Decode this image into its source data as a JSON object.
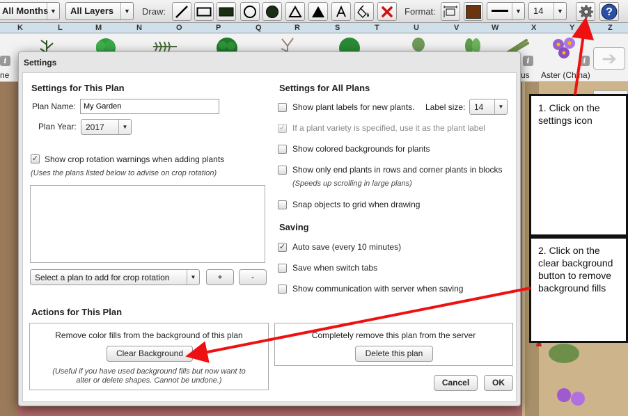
{
  "toolbar": {
    "months_label": "All Months",
    "layers_label": "All Layers",
    "draw_label": "Draw:",
    "format_label": "Format:",
    "label_size": "14",
    "colors": {
      "fill_swatch": "#6b3510",
      "delete_red": "#d01010",
      "help_blue": "#2a4fa8"
    }
  },
  "ruler": {
    "letters": [
      "K",
      "L",
      "M",
      "N",
      "O",
      "P",
      "Q",
      "R",
      "S",
      "T",
      "U",
      "V",
      "W",
      "X",
      "Y",
      "Z"
    ]
  },
  "plant_strip": {
    "left_label_fragment": "ne",
    "right_label_fragment": "us",
    "last_plant_label": "Aster (China)"
  },
  "dialog": {
    "title": "Settings",
    "plan": {
      "heading": "Settings for This Plan",
      "name_label": "Plan Name:",
      "name_value": "My Garden",
      "year_label": "Plan Year:",
      "year_value": "2017",
      "crop_rotation_label": "Show crop rotation warnings when adding plants",
      "crop_rotation_checked": true,
      "crop_rotation_note": "(Uses the plans listed below to advise on crop rotation)",
      "select_plan_label": "Select a plan to add for crop rotation",
      "add_label": "+",
      "remove_label": "-"
    },
    "all_plans": {
      "heading": "Settings for All Plans",
      "plant_labels": "Show plant labels for new plants.",
      "label_size_label": "Label size:",
      "label_size_value": "14",
      "variety_label": "If a plant variety is specified, use it as the plant label",
      "colored_bg": "Show colored backgrounds for plants",
      "end_plants": "Show only end plants in rows and corner plants in blocks",
      "end_plants_note": "(Speeds up scrolling in large plans)",
      "snap_grid": "Snap objects to grid when drawing"
    },
    "saving": {
      "heading": "Saving",
      "auto_save": "Auto save (every 10 minutes)",
      "auto_save_checked": true,
      "save_switch": "Save when switch tabs",
      "show_comm": "Show communication with server when saving"
    },
    "actions": {
      "heading": "Actions for This Plan",
      "remove_fills_text": "Remove color fills from the background of this plan",
      "clear_bg_button": "Clear Background",
      "clear_bg_note": "(Useful if you have used background fills but now want to alter or delete shapes. Cannot be undone.)",
      "delete_text": "Completely remove this plan from the server",
      "delete_button": "Delete this plan"
    },
    "cancel_button": "Cancel",
    "ok_button": "OK"
  },
  "callouts": {
    "one": "1. Click on the settings icon",
    "two": "2. Click on the clear background button to remove background fills"
  }
}
